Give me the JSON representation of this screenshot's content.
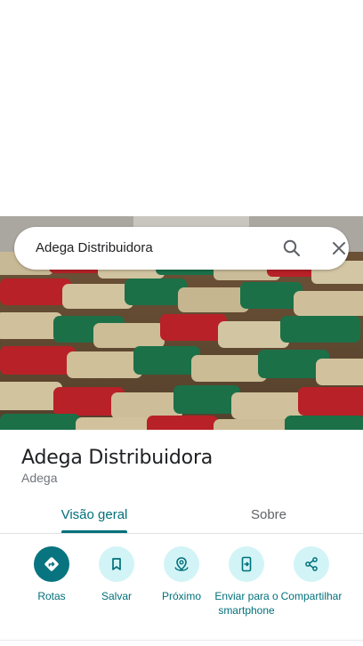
{
  "search": {
    "query": "Adega Distribuidora"
  },
  "place": {
    "name": "Adega Distribuidora",
    "category": "Adega"
  },
  "tabs": [
    {
      "label": "Visão geral",
      "selected": true
    },
    {
      "label": "Sobre",
      "selected": false
    }
  ],
  "actions": [
    {
      "label": "Rotas",
      "icon": "directions-icon"
    },
    {
      "label": "Salvar",
      "icon": "bookmark-icon"
    },
    {
      "label": "Próximo",
      "icon": "nearby-icon"
    },
    {
      "label": "Enviar para o smartphone",
      "icon": "send-to-phone-icon"
    },
    {
      "label": "Compartilhar",
      "icon": "share-icon"
    }
  ],
  "colors": {
    "accent": "#00707a",
    "primary_button": "#08747f",
    "action_bg": "#d2f4f7"
  }
}
